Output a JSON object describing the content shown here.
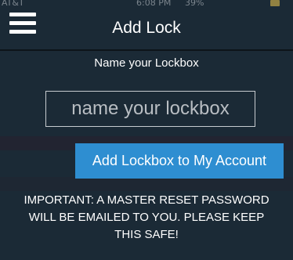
{
  "status_bar": {
    "carrier": "AT&T",
    "time": "6:08 PM",
    "battery": "39%",
    "battery_level": 0.39,
    "icons": [
      "wifi-icon",
      "location-icon",
      "alarm-icon",
      "headphones-icon",
      "battery-icon"
    ]
  },
  "header": {
    "title": "Add Lock",
    "menu_icon": "hamburger-menu-icon"
  },
  "form": {
    "label": "Name your Lockbox",
    "input_placeholder": "name your lockbox",
    "input_value": "",
    "submit_label": "Add Lockbox to My Account"
  },
  "notice": {
    "text": "IMPORTANT: A MASTER RESET PASSWORD WILL BE EMAILED TO YOU. PLEASE KEEP THIS SAFE!"
  },
  "colors": {
    "background": "#1b2a36",
    "accent": "#2e8ed1",
    "text": "#ffffff",
    "input_border": "#c7cbcf",
    "battery": "#f2c94c"
  }
}
